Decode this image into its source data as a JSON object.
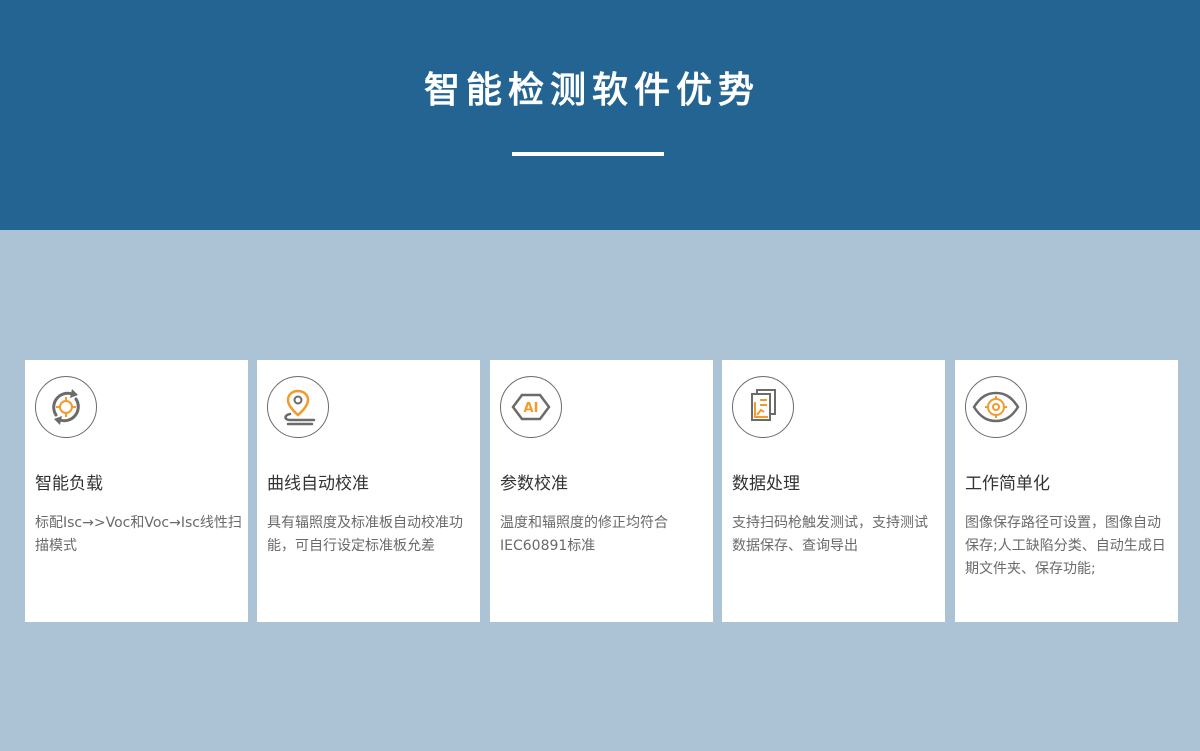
{
  "header": {
    "title": "智能检测软件优势"
  },
  "cards": [
    {
      "icon": "rotate-arrows-icon",
      "title": "智能负载",
      "desc": "标配Isc→>Voc和Voc→Isc线性扫描模式"
    },
    {
      "icon": "location-pin-icon",
      "title": "曲线自动校准",
      "desc": "具有辐照度及标准板自动校准功能，可自行设定标准板允差"
    },
    {
      "icon": "ai-hexagon-icon",
      "title": "参数校准",
      "desc": "温度和辐照度的修正均符合IEC60891标准"
    },
    {
      "icon": "documents-chart-icon",
      "title": "数据处理",
      "desc": "支持扫码枪触发测试，支持测试数据保存、查询导出"
    },
    {
      "icon": "eye-target-icon",
      "title": "工作简单化",
      "desc": "图像保存路径可设置，图像自动保存;人工缺陷分类、自动生成日期文件夹、保存功能;"
    }
  ],
  "colors": {
    "header_bg": "#246493",
    "page_bg": "#abc3d4",
    "accent": "#f39a2b",
    "icon_stroke": "#6b6b6b"
  }
}
